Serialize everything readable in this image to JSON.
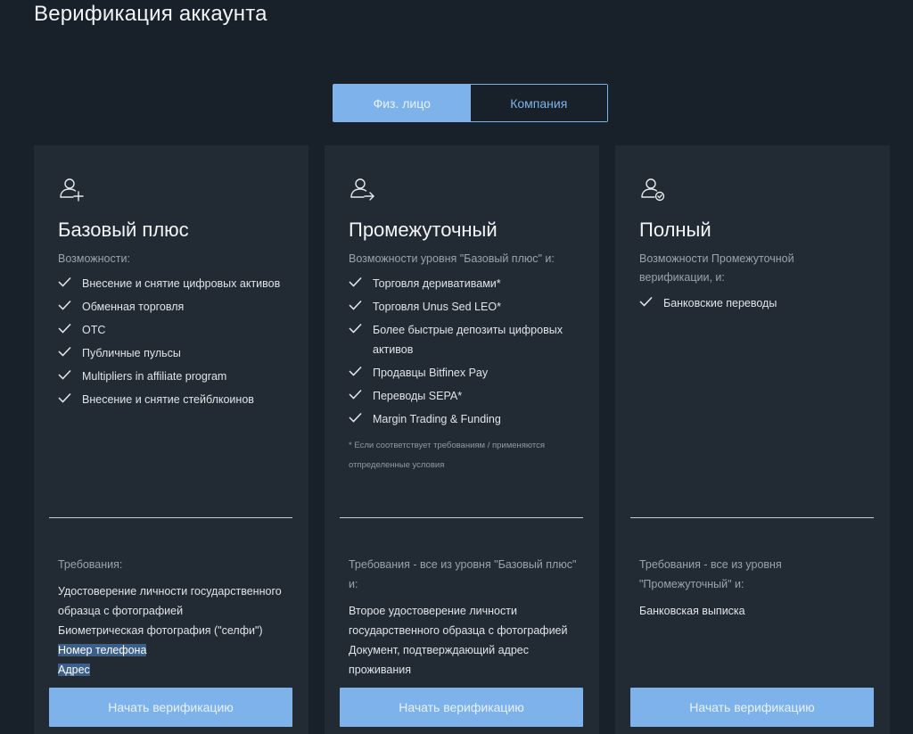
{
  "page": {
    "title": "Верификация аккаунта"
  },
  "switcher": {
    "tabs": [
      {
        "label": "Физ. лицо",
        "active": true
      },
      {
        "label": "Компания",
        "active": false
      }
    ]
  },
  "colors": {
    "accent": "#7db3ea",
    "background": "#182029",
    "card": "#222b34"
  },
  "cards": [
    {
      "icon": "user-plus-icon",
      "title": "Базовый плюс",
      "subtitle": "Возможности:",
      "features": [
        "Внесение и снятие цифровых активов",
        "Обменная торговля",
        "OTC",
        "Публичные пульсы",
        "Multipliers in affiliate program",
        "Внесение и снятие стейблкоинов"
      ],
      "footnote": "",
      "requirements_title": "Требования:",
      "requirements": [
        "Удостоверение личности государственного образца с фотографией",
        "Биометрическая фотография (\"селфи\")",
        "Номер телефона",
        "Адрес"
      ],
      "button": "Начать верификацию"
    },
    {
      "icon": "user-arrow-icon",
      "title": "Промежуточный",
      "subtitle": "Возможности уровня \"Базовый плюс\" и:",
      "features": [
        "Торговля деривативами*",
        "Торговля Unus Sed LEO*",
        "Более быстрые депозиты цифровых активов",
        "Продавцы Bitfinex Pay",
        "Переводы SEPA*",
        "Margin Trading & Funding"
      ],
      "footnote": "* Если соответствует требованиям / применяются отпределенные условия",
      "requirements_title": "Требования - все из уровня \"Базовый плюс\" и:",
      "requirements": [
        "Второе удостоверение личности государственного образца с фотографией",
        "Документ, подтверждающий адрес проживания"
      ],
      "button": "Начать верификацию"
    },
    {
      "icon": "user-check-icon",
      "title": "Полный",
      "subtitle": "Возможности Промежуточной верификации, и:",
      "features": [
        "Банковские переводы"
      ],
      "footnote": "",
      "requirements_title": "Требования - все из уровня \"Промежуточный\" и:",
      "requirements": [
        "Банковская выписка"
      ],
      "button": "Начать верификацию"
    }
  ]
}
